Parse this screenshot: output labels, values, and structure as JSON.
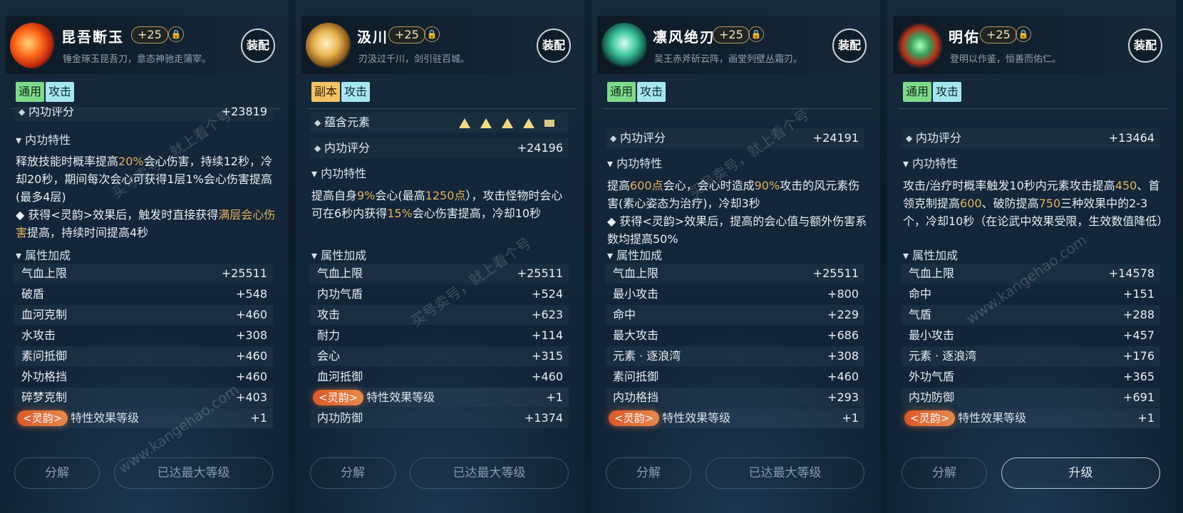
{
  "equip_label": "装配",
  "cards": [
    {
      "name": "昆吾断玉",
      "level": "+25",
      "desc": "锤金琢玉昆吾刀，意态神驰走蒲宰。",
      "tags": [
        "通用",
        "攻击"
      ],
      "score_label": "内功评分",
      "score": "+23819",
      "trait_title": "内功特性",
      "trait_lines": [
        "释放技能时概率提高",
        "20%",
        "会心伤害，持续12秒，冷却20秒，期间每次会心可获得1层1%会心伤害提高(最多4层)"
      ],
      "trait_extra": [
        "◆ 获得<灵韵>效果后，触发时直接获得",
        "满层会心伤害",
        "提高，持续时间提高4秒"
      ],
      "attr_title": "属性加成",
      "attrs": [
        [
          "气血上限",
          "+25511"
        ],
        [
          "破盾",
          "+548"
        ],
        [
          "血河克制",
          "+460"
        ],
        [
          "水攻击",
          "+308"
        ],
        [
          "素问抵御",
          "+460"
        ],
        [
          "外功格挡",
          "+460"
        ],
        [
          "碎梦克制",
          "+403"
        ]
      ],
      "lingyun": "<灵韵>",
      "lingyun_text": "特性效果等级",
      "lingyun_val": "+1",
      "btn_a": "分解",
      "btn_b": "已达最大等级"
    },
    {
      "name": "汲川",
      "level": "+25",
      "desc": "刃汲过千川，剑引驻百城。",
      "tags": [
        "副本",
        "攻击"
      ],
      "elem_label": "蕴含元素",
      "score_label": "内功评分",
      "score": "+24196",
      "trait_title": "内功特性",
      "trait_lines": [
        "提高自身",
        "9%",
        "会心(最高",
        "1250点",
        "），攻击怪物时会心可在6秒内获得",
        "15%",
        "会心伤害提高，冷却10秒"
      ],
      "attr_title": "属性加成",
      "attrs": [
        [
          "气血上限",
          "+25511"
        ],
        [
          "内功气盾",
          "+524"
        ],
        [
          "攻击",
          "+623"
        ],
        [
          "耐力",
          "+114"
        ],
        [
          "会心",
          "+315"
        ],
        [
          "血河抵御",
          "+460"
        ]
      ],
      "lingyun": "<灵韵>",
      "lingyun_text": "特性效果等级",
      "lingyun_val": "+1",
      "extra_attr": [
        "内功防御",
        "+1374"
      ],
      "btn_a": "分解",
      "btn_b": "已达最大等级"
    },
    {
      "name": "凛风绝刃",
      "level": "+25",
      "desc": "吴王赤斧斫云阵，画堂列壁丛霜刃。",
      "tags": [
        "通用",
        "攻击"
      ],
      "score_label": "内功评分",
      "score": "+24191",
      "trait_title": "内功特性",
      "trait_lines": [
        "提高",
        "600点",
        "会心，会心时造成",
        "90%",
        "攻击的风元素伤害(素心姿态为治疗)，冷却3秒"
      ],
      "trait_extra": [
        "◆ 获得<灵韵>效果后，提高的会心值与额外伤害系数均提高50%"
      ],
      "attr_title": "属性加成",
      "attrs": [
        [
          "气血上限",
          "+25511"
        ],
        [
          "最小攻击",
          "+800"
        ],
        [
          "命中",
          "+229"
        ],
        [
          "最大攻击",
          "+686"
        ],
        [
          "元素 · 逐浪湾",
          "+308"
        ],
        [
          "素问抵御",
          "+460"
        ],
        [
          "内功格挡",
          "+293"
        ]
      ],
      "lingyun": "<灵韵>",
      "lingyun_text": "特性效果等级",
      "lingyun_val": "+1",
      "btn_a": "分解",
      "btn_b": "已达最大等级"
    },
    {
      "name": "明佑",
      "level": "+25",
      "desc": "登明以作鉴，恒善而佑仁。",
      "tags": [
        "通用",
        "攻击"
      ],
      "score_label": "内功评分",
      "score": "+13464",
      "trait_title": "内功特性",
      "trait_lines": [
        "攻击/治疗时概率触发10秒内元素攻击提高",
        "450",
        "、首领克制提高",
        "600",
        "、破防提高",
        "750",
        "三种效果中的2-3个，冷却10秒（在论武中效果受限，生效数值降低）"
      ],
      "attr_title": "属性加成",
      "attrs": [
        [
          "气血上限",
          "+14578"
        ],
        [
          "命中",
          "+151"
        ],
        [
          "气盾",
          "+288"
        ],
        [
          "最小攻击",
          "+457"
        ],
        [
          "元素 · 逐浪湾",
          "+176"
        ],
        [
          "外功气盾",
          "+365"
        ],
        [
          "内功防御",
          "+691"
        ]
      ],
      "lingyun": "<灵韵>",
      "lingyun_text": "特性效果等级",
      "lingyun_val": "+1",
      "btn_a": "分解",
      "btn_b": "升级"
    }
  ],
  "watermark": "买号卖号，就上看个号",
  "watermark_site": "www.kangehao.com"
}
